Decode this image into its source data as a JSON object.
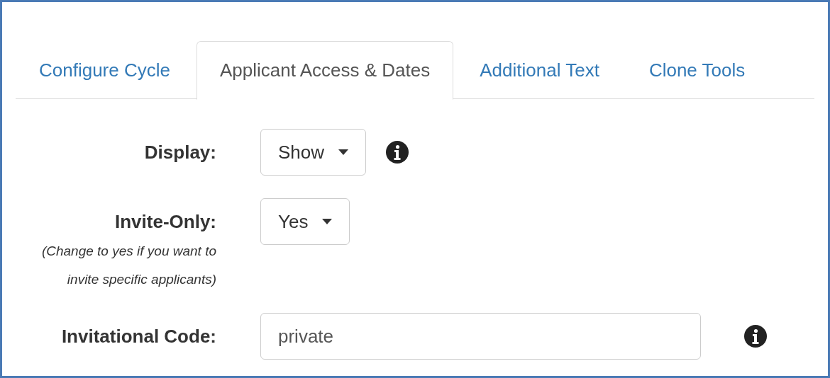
{
  "tabs": [
    {
      "label": "Configure Cycle",
      "selected": false
    },
    {
      "label": "Applicant Access & Dates",
      "selected": true
    },
    {
      "label": "Additional Text",
      "selected": false
    },
    {
      "label": "Clone Tools",
      "selected": false
    }
  ],
  "fields": [
    {
      "kind": "select",
      "label": "Display:",
      "value": "Show",
      "info": true
    },
    {
      "kind": "select",
      "label": "Invite-Only:",
      "value": "Yes",
      "note": "(Change to yes if you want to invite specific applicants)",
      "info": false
    },
    {
      "kind": "text",
      "label": "Invitational Code:",
      "value": "private",
      "info": true
    }
  ]
}
